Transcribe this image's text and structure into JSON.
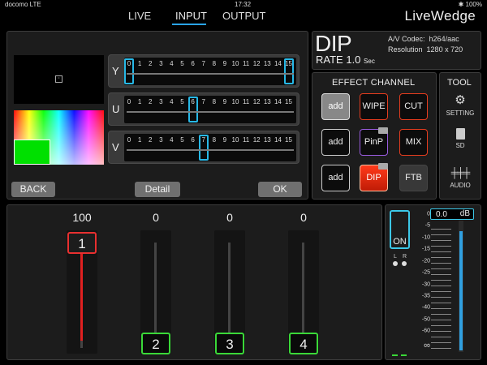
{
  "status": {
    "carrier": "docomo  LTE",
    "time": "17:32",
    "right": "✱ 100%"
  },
  "nav": {
    "tabs": [
      "LIVE",
      "INPUT",
      "OUTPUT"
    ],
    "active": "INPUT",
    "brand": "LiveWedge"
  },
  "color_panel": {
    "preview_marker": "▫",
    "sliders": [
      {
        "label": "Y",
        "value": 0,
        "value2": 15
      },
      {
        "label": "U",
        "value": 6
      },
      {
        "label": "V",
        "value": 7
      }
    ],
    "scale": [
      "0",
      "1",
      "2",
      "3",
      "4",
      "5",
      "6",
      "7",
      "8",
      "9",
      "10",
      "11",
      "12",
      "13",
      "14",
      "15"
    ],
    "back_label": "BACK",
    "detail_label": "Detail",
    "ok_label": "OK"
  },
  "effect_info": {
    "title": "DIP",
    "rate_label": "RATE",
    "rate_value": "1.0",
    "rate_unit": "Sec",
    "codec_label": "A/V Codec:",
    "codec_value": "h264/aac",
    "resolution_label": "Resolution",
    "resolution_value": "1280 x 720"
  },
  "effect_channel": {
    "title": "EFFECT CHANNEL",
    "add1": "add",
    "wipe": "WIPE",
    "cut": "CUT",
    "add2": "add",
    "pinp": "PinP",
    "mix": "MIX",
    "add3": "add",
    "dip": "DIP",
    "ftb": "FTB"
  },
  "tools": {
    "title": "TOOL",
    "setting": "SETTING",
    "sd": "SD",
    "audio": "AUDIO"
  },
  "faders": [
    {
      "label": "1",
      "value": "100",
      "level": 1.0,
      "color": "#e83030"
    },
    {
      "label": "2",
      "value": "0",
      "level": 0.0,
      "color": "#3ad838"
    },
    {
      "label": "3",
      "value": "0",
      "level": 0.0,
      "color": "#3ad838"
    },
    {
      "label": "4",
      "value": "0",
      "level": 0.0,
      "color": "#3ad838"
    }
  ],
  "audio": {
    "on_label": "ON",
    "l_label": "L",
    "r_label": "R",
    "db_value": "0.0",
    "db_unit": "dB",
    "scale": [
      "0",
      "-5",
      "-10",
      "-15",
      "-20",
      "-25",
      "-30",
      "-35",
      "-40",
      "-50",
      "-60",
      "∞"
    ],
    "level": 0.93
  },
  "colors": {
    "accent": "#27b8e6",
    "red": "#e83030",
    "green": "#3ad838"
  }
}
